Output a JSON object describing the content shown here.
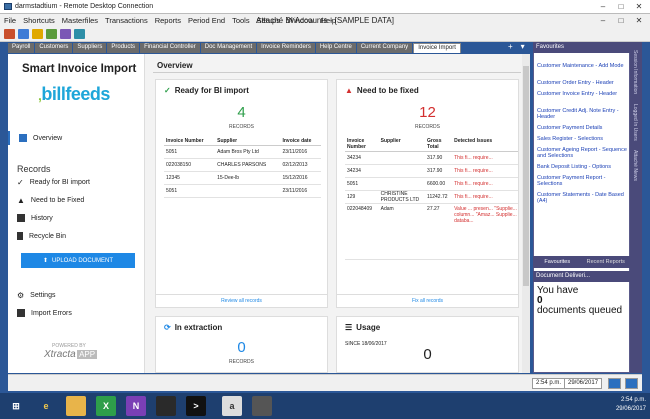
{
  "rdp": {
    "title": "darmstadtium - Remote Desktop Connection"
  },
  "app": {
    "title": "Attaché BI Accounts - [SAMPLE DATA]",
    "menus": [
      "File",
      "Shortcuts",
      "Masterfiles",
      "Transactions",
      "Reports",
      "Period End",
      "Tools",
      "Setups",
      "Window",
      "Help"
    ]
  },
  "tabs": [
    "Payroll",
    "Customers",
    "Suppliers",
    "Products",
    "Financial Controller",
    "Doc Management",
    "Invoice Reminders",
    "Help Centre",
    "Current Company",
    "Invoice Import"
  ],
  "tab_tools": {
    "add": "+",
    "pin": "▾",
    "close": "×"
  },
  "left": {
    "brand": "Smart Invoice Import",
    "logo_a": "billfeeds",
    "overview": "Overview",
    "records_title": "Records",
    "ready": "Ready for BI import",
    "need": "Need to be Fixed",
    "history": "History",
    "recycle": "Recycle Bin",
    "upload": "UPLOAD DOCUMENT",
    "settings": "Settings",
    "import_errors": "Import Errors",
    "powered": "POWERED BY",
    "xtracta": "Xtracta",
    "app": "APP"
  },
  "overview": {
    "title": "Overview",
    "ready_card": {
      "title": "Ready for BI import",
      "count": "4",
      "records": "RECORDS",
      "headers": [
        "Invoice Number",
        "Supplier",
        "Invoice date"
      ],
      "rows": [
        [
          "5051",
          "Adam Bros Pty Ltd",
          "23/11/2016"
        ],
        [
          "022038150",
          "CHARLES PARSONS",
          "02/12/2013"
        ],
        [
          "12345",
          "15-Dee-lb",
          "15/12/2016"
        ],
        [
          "5051",
          "",
          "23/11/2016"
        ]
      ],
      "footer": "Review all records"
    },
    "fix_card": {
      "title": "Need to be fixed",
      "count": "12",
      "records": "RECORDS",
      "headers": [
        "Invoice Number",
        "Supplier",
        "Gross Total",
        "Detected Issues"
      ],
      "rows": [
        [
          "34234",
          "",
          "317.90",
          "This fi... require..."
        ],
        [
          "34234",
          "",
          "317.90",
          "This fi... require..."
        ],
        [
          "5051",
          "",
          "6600.00",
          "This fi... require..."
        ],
        [
          "129",
          "CHRISTINE PRODUCTS LTD",
          "11242.72",
          "This fi... require..."
        ],
        [
          "022048409",
          "Adam",
          "27.27",
          "Value ... presen... \"Supplie... column... \"Amaz... Supplie... databa..."
        ]
      ],
      "footer": "Fix all records"
    },
    "extraction_card": {
      "title": "In extraction",
      "count": "0",
      "records": "RECORDS"
    },
    "usage_card": {
      "title": "Usage",
      "since": "SINCE 18/06/2017",
      "count": "0"
    }
  },
  "favourites": {
    "header": "Favourites",
    "items": [
      "Customer Maintenance - Add Mode",
      "Customer Order Entry - Header",
      "Customer Invoice Entry - Header",
      "Customer Credit Adj. Note Entry - Header",
      "Customer Payment Details",
      "Sales Register - Selections",
      "Customer Ageing Report - Sequence and Selections",
      "Bank Deposit Listing - Options",
      "Customer Payment Report - Selections",
      "Customer Statements - Date Based (A4)"
    ],
    "tab_fav": "Favourites",
    "tab_recent": "Recent Reports"
  },
  "doc_delivery": {
    "header": "Document Deliveri...",
    "line1": "You have",
    "line2": "0",
    "line3": "documents queued"
  },
  "vertical_strip": [
    "Session Information",
    "Logged In Users",
    "Attaché News"
  ],
  "status": {
    "time": "2:54 p.m.",
    "date": "29/06/2017"
  },
  "tray": {
    "time": "2:54 p.m.",
    "date": "29/06/2017"
  },
  "colors": {
    "accent": "#1e88e5",
    "ready": "#2e9e4a",
    "fix": "#d32f2f",
    "panel": "#4a4a7a"
  }
}
